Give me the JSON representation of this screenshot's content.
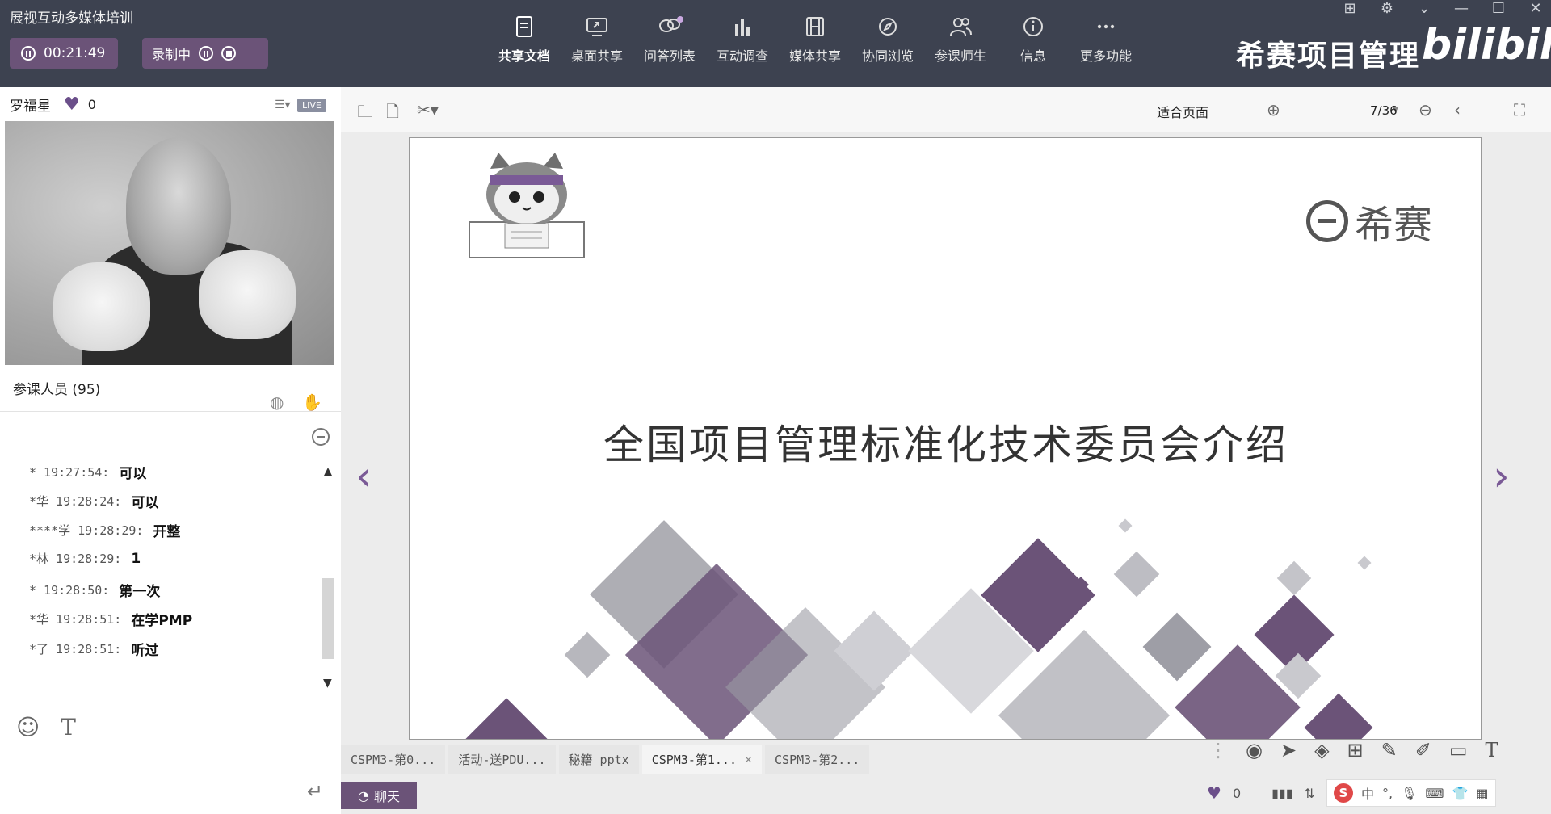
{
  "app_title": "展视互动多媒体培训",
  "timer": "00:21:49",
  "recording_label": "录制中",
  "toolbar": {
    "items": [
      {
        "label": "共享文档",
        "icon": "document-icon"
      },
      {
        "label": "桌面共享",
        "icon": "desktop-share-icon"
      },
      {
        "label": "问答列表",
        "icon": "qa-bubble-icon"
      },
      {
        "label": "互动调查",
        "icon": "bar-chart-icon"
      },
      {
        "label": "媒体共享",
        "icon": "film-icon"
      },
      {
        "label": "协同浏览",
        "icon": "compass-icon"
      },
      {
        "label": "参课师生",
        "icon": "people-icon"
      },
      {
        "label": "信息",
        "icon": "info-icon"
      },
      {
        "label": "更多功能",
        "icon": "more-icon"
      }
    ]
  },
  "brand": "希赛项目管理",
  "bilibili": "bilibili",
  "presenter": {
    "name": "罗福星",
    "likes": "0",
    "live_badge": "LIVE"
  },
  "participants_label": "参课人员 (95)",
  "chat_messages": [
    {
      "who": "* 19:27:54:",
      "text": "可以"
    },
    {
      "who": "*华 19:28:24:",
      "text": "可以"
    },
    {
      "who": "****学 19:28:29:",
      "text": "开整"
    },
    {
      "who": "*林 19:28:29:",
      "text": "1"
    },
    {
      "who": "* 19:28:50:",
      "text": "第一次"
    },
    {
      "who": "*华 19:28:51:",
      "text": "在学PMP"
    },
    {
      "who": "*了 19:28:51:",
      "text": "听过"
    }
  ],
  "doc": {
    "zoom": "适合页面",
    "page": "7/36",
    "slide_title": "全国项目管理标准化技术委员会介绍",
    "slide_logo": "希赛"
  },
  "doc_tabs": [
    {
      "label": "CSPM3-第0..."
    },
    {
      "label": "活动-送PDU..."
    },
    {
      "label": "秘籍 pptx"
    },
    {
      "label": "CSPM3-第1..."
    },
    {
      "label": "CSPM3-第2..."
    }
  ],
  "chat_button": "聊天",
  "status": {
    "likes": "0",
    "ime_lang": "中"
  },
  "colors": {
    "topbar": "#3d4250",
    "accent": "#6b5378",
    "brand_purple": "#7a5a96"
  }
}
